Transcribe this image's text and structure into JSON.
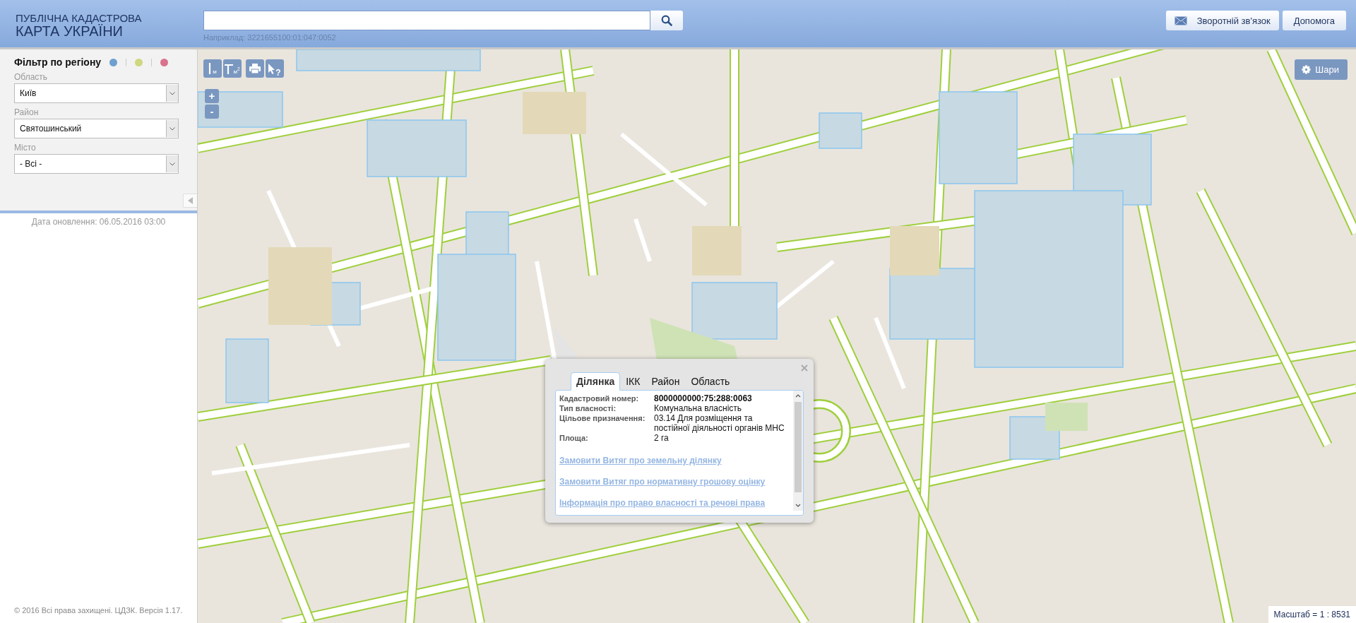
{
  "header": {
    "logo_line_1": "ПУБЛІЧНА КАДАСТРОВА",
    "logo_line_2": "КАРТА УКРАЇНИ",
    "search": {
      "hint": "Наприклад: 3221655100:01:047:0052"
    },
    "buttons": [
      {
        "kind": "feedback",
        "label": "Зворотній зв'язок"
      },
      {
        "kind": "help",
        "label": "Допомога"
      }
    ]
  },
  "sidebar": {
    "title": "Фільтр по регіону",
    "color_dots": [
      {
        "color": "#6f9fd0"
      },
      {
        "color": "#cfd77f"
      },
      {
        "color": "#d9728d"
      }
    ],
    "filters": [
      {
        "label": "Область",
        "value": "Київ"
      },
      {
        "label": "Район",
        "value": "Святошинський"
      },
      {
        "label": "Місто",
        "value": "- Всі -"
      }
    ],
    "updated": "Дата оновлення: 06.05.2016 03:00",
    "footer": "© 2016 Всі права захищені. ЦДЗК. Версія 1.17."
  },
  "map": {
    "tools": [
      {
        "kind": "ruler",
        "label": "м"
      },
      {
        "kind": "area",
        "label": "м$^{2}$"
      },
      {
        "kind": "print"
      },
      {
        "kind": "identify",
        "label": "?"
      }
    ],
    "zoom": [
      "+",
      "-"
    ],
    "layers_button": "Шари",
    "scale": "Масштаб = 1 : 8531",
    "popup": {
      "tabs": [
        {
          "label": "Ділянка",
          "selected": true
        },
        {
          "label": "ІКК",
          "selected": false
        },
        {
          "label": "Район",
          "selected": false
        },
        {
          "label": "Область",
          "selected": false
        }
      ],
      "fields": [
        {
          "label": "Кадастровий номер:",
          "value": "8000000000:75:288:0063",
          "kind": "strong"
        },
        {
          "label": "Тип власності:",
          "value": "Комунальна власність",
          "kind": "plain"
        },
        {
          "label": "Цільове призначення:",
          "value": "03.14 Для розміщення та постійної діяльності органів МНС",
          "kind": "plain"
        },
        {
          "label": "Площа:",
          "value": "2 га",
          "kind": "plain"
        }
      ],
      "links": [
        "Замовити Витяг про земельну ділянку",
        "Замовити Витяг про нормативну грошову оцінку",
        "Інформація про право власності та речові права"
      ]
    }
  }
}
